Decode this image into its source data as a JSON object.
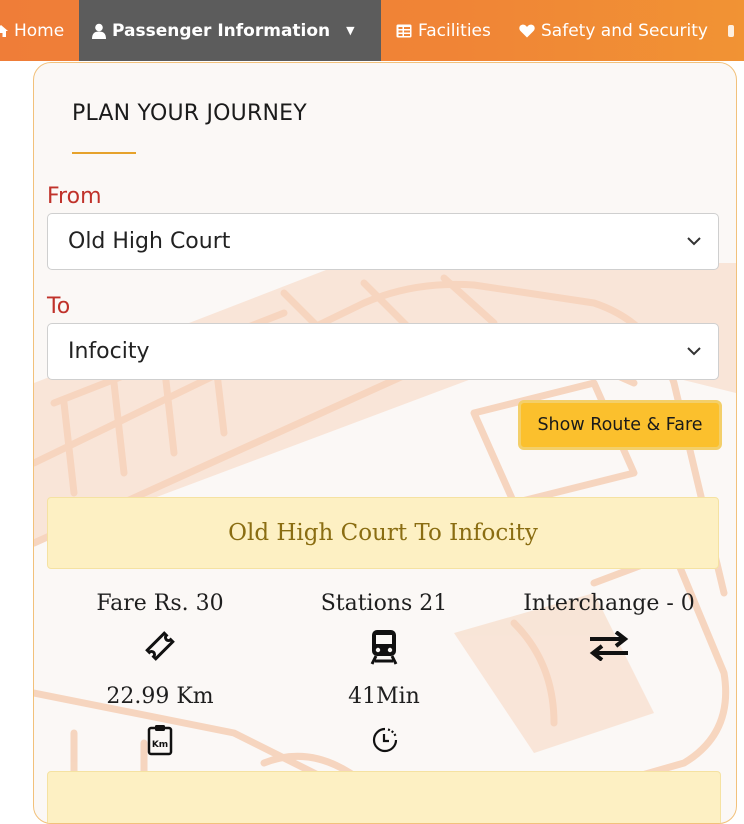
{
  "nav": {
    "home": "Home",
    "passenger": "Passenger Information",
    "facilities": "Facilities",
    "safety": "Safety and Security"
  },
  "colors": {
    "nav_gradient_start": "#ef7d38",
    "nav_active": "#5c5c5c",
    "label_red": "#c0322b",
    "button_yellow": "#fbc02d",
    "banner": "#fdf0c3"
  },
  "journey": {
    "heading": "PLAN YOUR JOURNEY",
    "from_label": "From",
    "from_value": "Old High Court",
    "to_label": "To",
    "to_value": "Infocity",
    "button": "Show Route & Fare"
  },
  "result": {
    "title": "Old High Court To Infocity",
    "fare": "Fare Rs. 30",
    "stations": "Stations 21",
    "interchange": "Interchange - 0",
    "distance": "22.99 Km",
    "time": "41Min"
  },
  "icons": [
    "home-icon",
    "user-icon",
    "caret-down-icon",
    "facilities-icon",
    "heart-icon",
    "chevron-down-icon",
    "ticket-icon",
    "train-icon",
    "swap-arrows-icon",
    "clipboard-km-icon",
    "clock-icon"
  ]
}
